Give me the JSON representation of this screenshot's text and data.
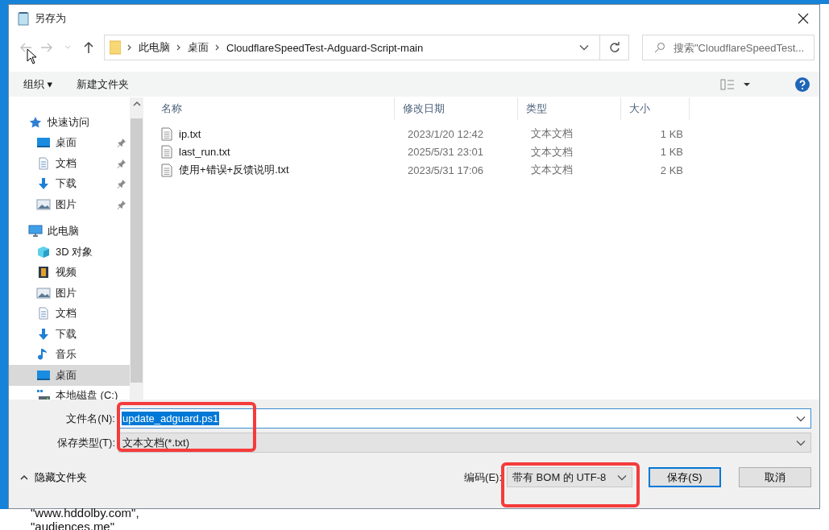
{
  "window": {
    "title": "另存为"
  },
  "address": {
    "crumbs": [
      "此电脑",
      "桌面",
      "CloudflareSpeedTest-Adguard-Script-main"
    ]
  },
  "search": {
    "placeholder": "搜索\"CloudflareSpeedTest..."
  },
  "toolbar": {
    "organize": "组织 ▾",
    "new_folder": "新建文件夹"
  },
  "navigation": [
    {
      "label": "快速访问",
      "kind": "star",
      "selected": false,
      "children": [
        {
          "label": "桌面",
          "kind": "desktop",
          "pinned": true,
          "selected": false
        },
        {
          "label": "文档",
          "kind": "document",
          "pinned": true,
          "selected": false
        },
        {
          "label": "下载",
          "kind": "download",
          "pinned": true,
          "selected": false
        },
        {
          "label": "图片",
          "kind": "picture",
          "pinned": true,
          "selected": false
        }
      ]
    },
    {
      "label": "此电脑",
      "kind": "computer",
      "selected": false,
      "children": [
        {
          "label": "3D 对象",
          "kind": "cube",
          "pinned": false,
          "selected": false
        },
        {
          "label": "视频",
          "kind": "video",
          "pinned": false,
          "selected": false
        },
        {
          "label": "图片",
          "kind": "picture",
          "pinned": false,
          "selected": false
        },
        {
          "label": "文档",
          "kind": "document",
          "pinned": false,
          "selected": false
        },
        {
          "label": "下载",
          "kind": "download",
          "pinned": false,
          "selected": false
        },
        {
          "label": "音乐",
          "kind": "music",
          "pinned": false,
          "selected": false
        },
        {
          "label": "桌面",
          "kind": "desktop",
          "pinned": false,
          "selected": true
        },
        {
          "label": "本地磁盘 (C:)",
          "kind": "drive",
          "pinned": false,
          "selected": false
        }
      ]
    }
  ],
  "table": {
    "columns": [
      "名称",
      "修改日期",
      "类型",
      "大小"
    ],
    "rows": [
      {
        "name": "ip.txt",
        "modified": "2023/1/20 12:42",
        "type": "文本文档",
        "size": "1 KB"
      },
      {
        "name": "last_run.txt",
        "modified": "2025/5/31 23:01",
        "type": "文本文档",
        "size": "1 KB"
      },
      {
        "name": "使用+错误+反馈说明.txt",
        "modified": "2023/5/31 17:06",
        "type": "文本文档",
        "size": "2 KB"
      }
    ]
  },
  "form": {
    "filename_label": "文件名(N):",
    "filename": "update_adguard.ps1",
    "filetype_label": "保存类型(T):",
    "filetype": "文本文档(*.txt)"
  },
  "footer": {
    "hide_folders": "隐藏文件夹",
    "encoding_label": "编码(E):",
    "encoding": "带有 BOM 的 UTF-8",
    "save": "保存(S)",
    "cancel": "取消"
  },
  "background_text": [
    "\"www.hddolby.com\",",
    "\"audiences.me\""
  ]
}
